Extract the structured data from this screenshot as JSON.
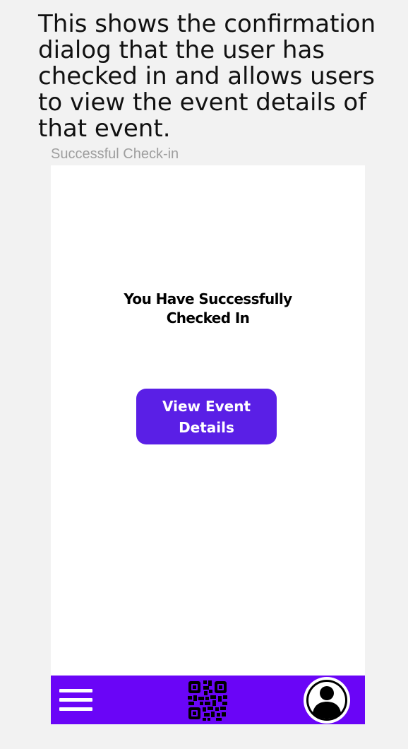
{
  "description": {
    "text": "This shows the confirmation dialog that the user has checked in and allows users to view the event details of that event."
  },
  "frame": {
    "label": "Successful Check-in"
  },
  "screen": {
    "message_line1": "You Have Successfully",
    "message_line2": "Checked In",
    "view_button_label": "View Event Details"
  },
  "nav": {
    "menu_icon": "hamburger-menu-icon",
    "qr_icon": "qr-code-icon",
    "profile_icon": "user-profile-icon"
  },
  "colors": {
    "background": "#f2f2f2",
    "button": "#5a1fe6",
    "nav_bar": "#6a05f7"
  }
}
